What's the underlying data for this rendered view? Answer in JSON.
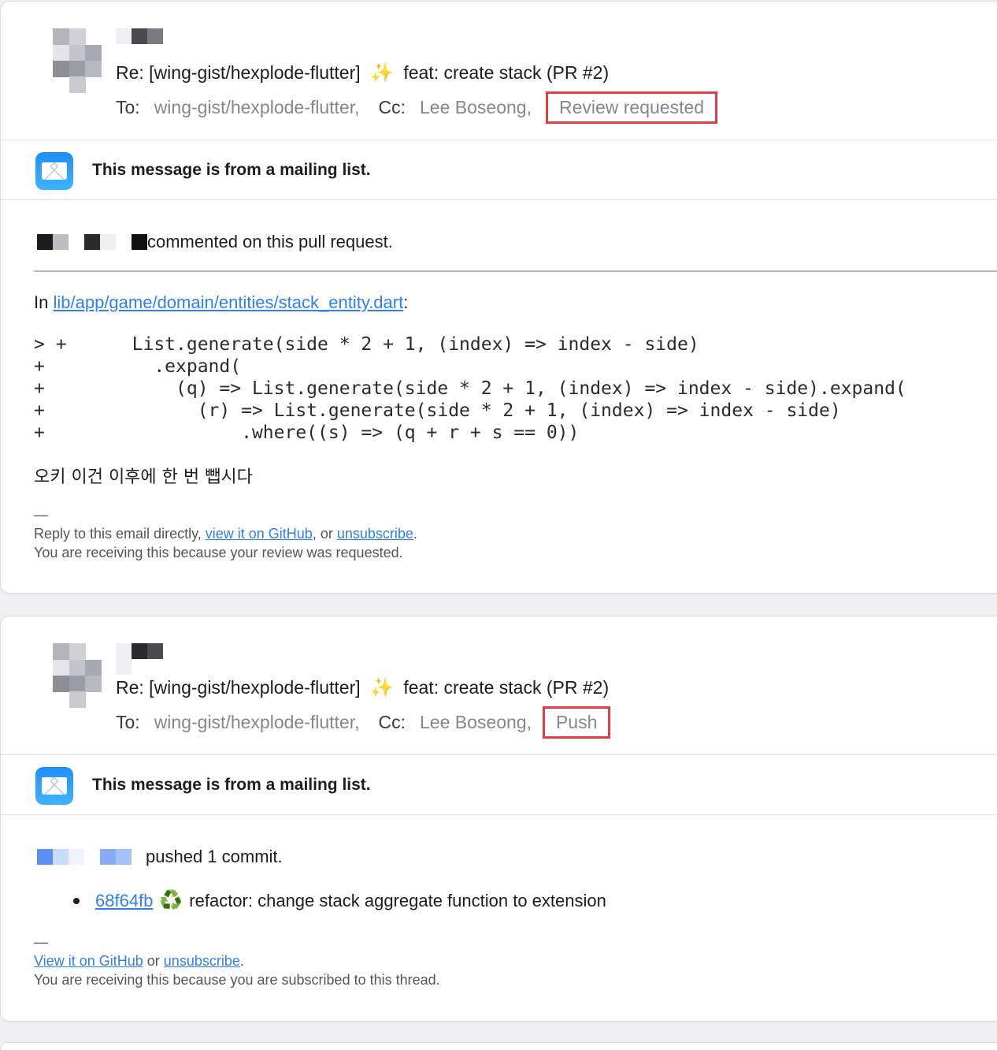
{
  "messages": [
    {
      "subject_prefix": "Re: [wing-gist/hexplode-flutter]",
      "subject_sparkle": "✨",
      "subject_rest": "feat: create stack (PR #2)",
      "to_label": "To:",
      "to_value": "wing-gist/hexplode-flutter,",
      "cc_label": "Cc:",
      "cc_value": "Lee Boseong,",
      "tag": "Review requested",
      "mailing_list_notice": "This message is from a mailing list.",
      "action": "commented on this pull request.",
      "file_prefix": "In",
      "file_link": "lib/app/game/domain/entities/stack_entity.dart",
      "file_suffix": ":",
      "code": "> +      List.generate(side * 2 + 1, (index) => index - side)\n+          .expand(\n+            (q) => List.generate(side * 2 + 1, (index) => index - side).expand(\n+              (r) => List.generate(side * 2 + 1, (index) => index - side)\n+                  .where((s) => (q + r + s == 0))",
      "comment": "오키 이건 이후에 한 번 뺍시다",
      "dash": "—",
      "footer_text_1": "Reply to this email directly,",
      "footer_link_1": "view it on GitHub",
      "footer_text_2": ", or",
      "footer_link_2": "unsubscribe",
      "footer_text_3": ".",
      "footer_line_2": "You are receiving this because your review was requested."
    },
    {
      "subject_prefix": "Re: [wing-gist/hexplode-flutter]",
      "subject_sparkle": "✨",
      "subject_rest": "feat: create stack (PR #2)",
      "to_label": "To:",
      "to_value": "wing-gist/hexplode-flutter,",
      "cc_label": "Cc:",
      "cc_value": "Lee Boseong,",
      "tag": "Push",
      "mailing_list_notice": "This message is from a mailing list.",
      "action": "pushed 1 commit.",
      "commit_hash": "68f64fb",
      "commit_icon": "♻️",
      "commit_message": "refactor: change stack aggregate function to extension",
      "dash": "—",
      "footer_link_1": "View it on GitHub",
      "footer_text_2": "or",
      "footer_link_2": "unsubscribe",
      "footer_text_3": ".",
      "footer_line_2": "You are receiving this because you are subscribed to this thread."
    }
  ],
  "colors": {
    "tag_border": "#e03d47",
    "link": "#2f7ff0",
    "mail_icon": "#1f8efa"
  }
}
